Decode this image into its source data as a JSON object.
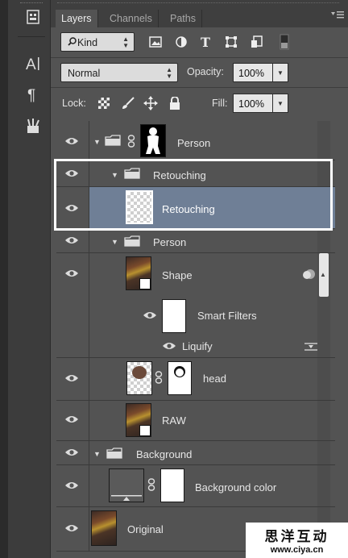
{
  "tabs": {
    "layers": "Layers",
    "channels": "Channels",
    "paths": "Paths"
  },
  "filter": {
    "kind_label": "Kind"
  },
  "blend": {
    "mode": "Normal",
    "opacity_label": "Opacity:",
    "opacity_value": "100%"
  },
  "lock": {
    "label": "Lock:",
    "fill_label": "Fill:",
    "fill_value": "100%"
  },
  "layers": {
    "person_top": "Person",
    "retouching_group": "Retouching",
    "retouching_layer": "Retouching",
    "person_group": "Person",
    "shape": "Shape",
    "smart_filters": "Smart Filters",
    "liquify": "Liquify",
    "head": "head",
    "raw": "RAW",
    "background_group": "Background",
    "background_color": "Background color",
    "original": "Original"
  },
  "watermark": {
    "chinese": "思洋互动",
    "url": "www.ciya.cn"
  },
  "colors": {
    "selected_row": "#6f7f96",
    "panel_bg": "#535353"
  }
}
